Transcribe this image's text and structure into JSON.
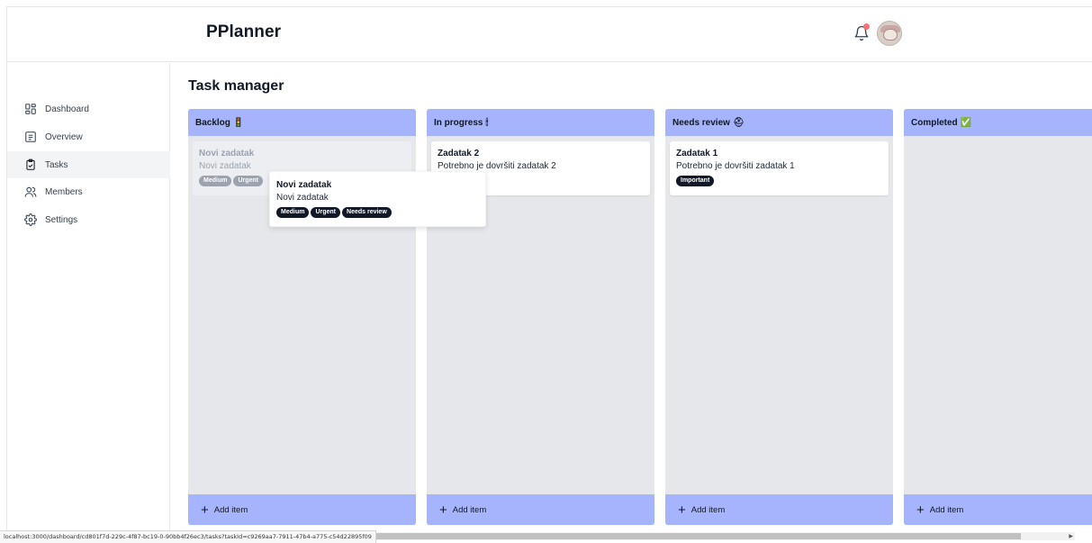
{
  "header": {
    "brand": "PPlanner"
  },
  "sidebar": {
    "items": [
      {
        "label": "Dashboard",
        "icon": "dashboard-icon",
        "active": false
      },
      {
        "label": "Overview",
        "icon": "overview-icon",
        "active": false
      },
      {
        "label": "Tasks",
        "icon": "tasks-icon",
        "active": true
      },
      {
        "label": "Members",
        "icon": "members-icon",
        "active": false
      },
      {
        "label": "Settings",
        "icon": "settings-icon",
        "active": false
      }
    ]
  },
  "main": {
    "title": "Task manager"
  },
  "columns": [
    {
      "title": "Backlog",
      "emoji": "🚦",
      "add_label": "Add item",
      "cards": [
        {
          "title": "Novi zadatak",
          "description": "Novi zadatak",
          "tags": [
            "Medium",
            "Urgent"
          ],
          "ghost": true
        }
      ]
    },
    {
      "title": "In progress",
      "emoji": "🕯",
      "add_label": "Add item",
      "cards": [
        {
          "title": "Zadatak 2",
          "description": "Potrebno je dovršiti zadatak 2",
          "tags": []
        }
      ]
    },
    {
      "title": "Needs review",
      "emoji": "⛑",
      "add_label": "Add item",
      "cards": [
        {
          "title": "Zadatak 1",
          "description": "Potrebno je dovršiti zadatak 1",
          "tags": [
            "Important"
          ]
        }
      ]
    },
    {
      "title": "Completed",
      "emoji": "✅",
      "add_label": "Add item",
      "cards": []
    }
  ],
  "dragging_card": {
    "title": "Novi zadatak",
    "description": "Novi zadatak",
    "tags": [
      "Medium",
      "Urgent",
      "Needs review"
    ]
  },
  "status_url": "localhost:3000/dashboard/cd801f7d-229c-4f87-bc19-0-90bb4f26ec3/tasks?taskId=c9269aa7-7911-47b4-a775-c54d22895f09",
  "colors": {
    "accent": "#a5b4fc",
    "column_bg": "#e5e7eb",
    "badge": "#111827",
    "notification": "#f87171"
  }
}
